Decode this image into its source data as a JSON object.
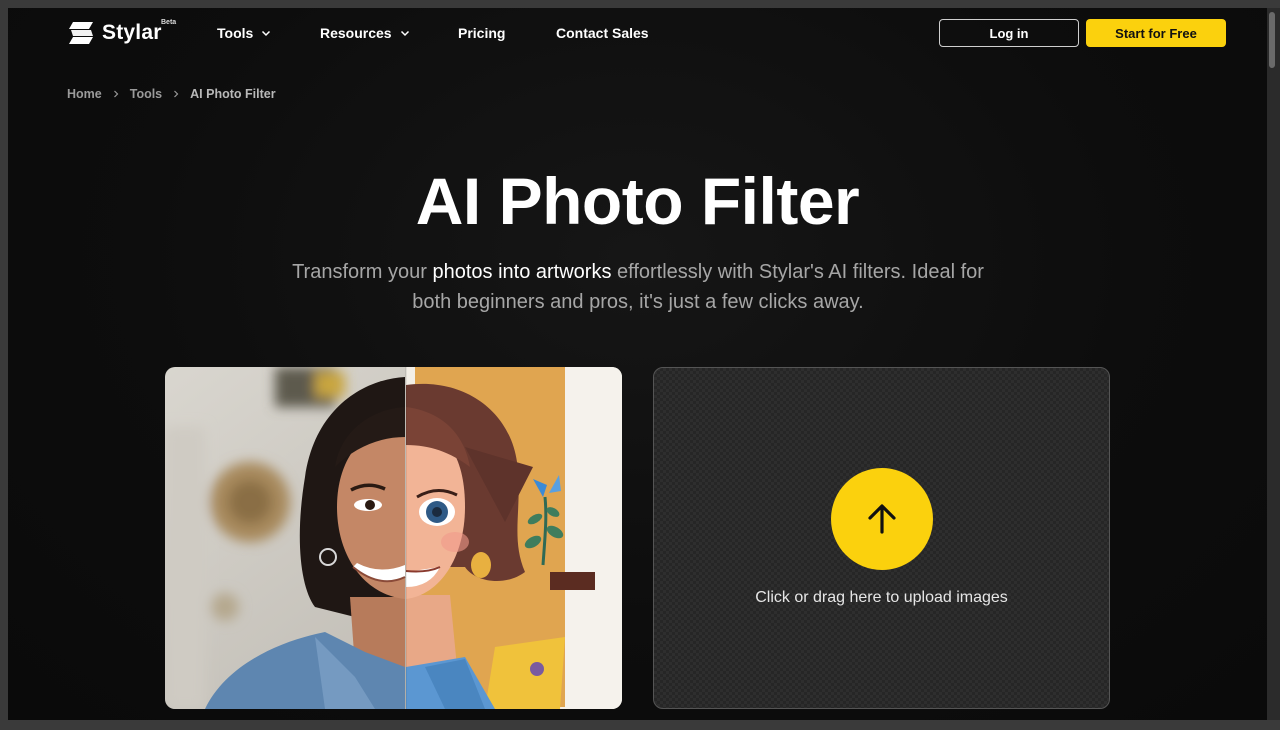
{
  "brand": {
    "name": "Stylar",
    "badge": "Beta"
  },
  "nav": {
    "items": [
      {
        "label": "Tools",
        "dropdown": true
      },
      {
        "label": "Resources",
        "dropdown": true
      },
      {
        "label": "Pricing",
        "dropdown": false
      },
      {
        "label": "Contact Sales",
        "dropdown": false
      }
    ],
    "login_label": "Log in",
    "start_label": "Start for Free"
  },
  "breadcrumb": [
    "Home",
    "Tools",
    "AI Photo Filter"
  ],
  "hero": {
    "title": "AI Photo Filter",
    "subtitle_1": "Transform your ",
    "subtitle_highlight": "photos into artworks",
    "subtitle_2": " effortlessly with Stylar's AI filters. Ideal for both beginners and pros, it's just a few clicks away."
  },
  "upload": {
    "text": "Click or drag here to upload images"
  },
  "colors": {
    "accent": "#fbd10d",
    "background": "#0d0d0d"
  }
}
